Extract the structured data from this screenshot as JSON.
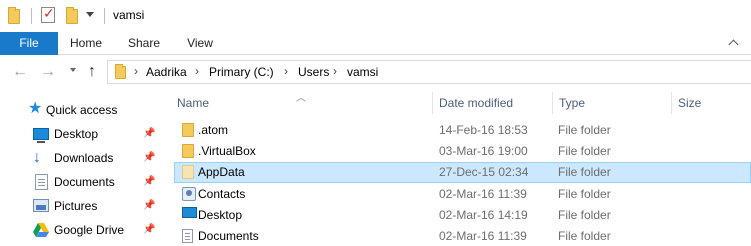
{
  "titlebar": {
    "title": "vamsi",
    "icons": [
      "folder-icon",
      "properties-check-icon",
      "new-folder-icon",
      "customize-quick-access-dropdown-icon"
    ]
  },
  "ribbon": {
    "tabs": [
      {
        "label": "File",
        "active": true
      },
      {
        "label": "Home"
      },
      {
        "label": "Share"
      },
      {
        "label": "View"
      }
    ],
    "accent_color": "#1979ca"
  },
  "navigation": {
    "back_icon": "left-arrow-icon",
    "forward_icon": "right-arrow-icon",
    "recent_icon": "chevron-down-icon",
    "up_icon": "up-arrow-icon"
  },
  "address": {
    "crumbs": [
      "Aadrika",
      "Primary (C:)",
      "Users",
      "vamsi"
    ]
  },
  "navpane": {
    "items": [
      {
        "label": "Quick access",
        "icon": "star-icon",
        "pinned": false
      },
      {
        "label": "Desktop",
        "icon": "desktop-icon",
        "pinned": true
      },
      {
        "label": "Downloads",
        "icon": "download-icon",
        "pinned": true
      },
      {
        "label": "Documents",
        "icon": "documents-icon",
        "pinned": true
      },
      {
        "label": "Pictures",
        "icon": "pictures-icon",
        "pinned": true
      },
      {
        "label": "Google Drive",
        "icon": "google-drive-icon",
        "pinned": true
      }
    ]
  },
  "columns": {
    "name": "Name",
    "date": "Date modified",
    "type": "Type",
    "size": "Size"
  },
  "rows": [
    {
      "name": ".atom",
      "date": "14-Feb-16 18:53",
      "type": "File folder",
      "icon": "folder-icon"
    },
    {
      "name": ".VirtualBox",
      "date": "03-Mar-16 19:00",
      "type": "File folder",
      "icon": "folder-icon"
    },
    {
      "name": "AppData",
      "date": "27-Dec-15 02:34",
      "type": "File folder",
      "icon": "folder-icon",
      "selected": true
    },
    {
      "name": "Contacts",
      "date": "02-Mar-16 11:39",
      "type": "File folder",
      "icon": "contacts-icon"
    },
    {
      "name": "Desktop",
      "date": "02-Mar-16 14:19",
      "type": "File folder",
      "icon": "desktop-icon"
    },
    {
      "name": "Documents",
      "date": "02-Mar-16 11:39",
      "type": "File folder",
      "icon": "documents-icon"
    }
  ],
  "colors": {
    "selection": "#cce8ff",
    "selection_border": "#99d1ff",
    "folder": "#f4c95d"
  }
}
